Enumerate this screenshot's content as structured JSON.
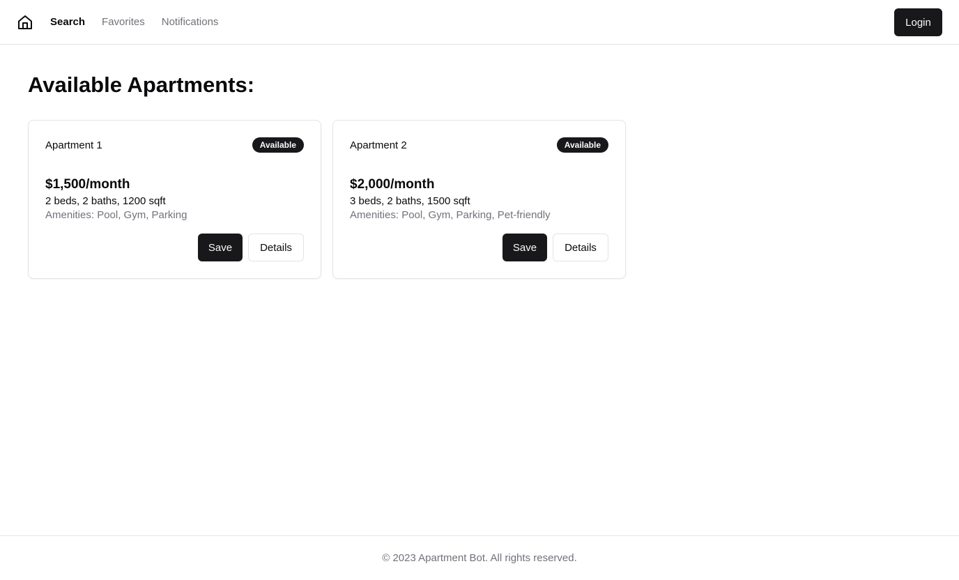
{
  "header": {
    "home_icon": "home-icon",
    "nav": [
      {
        "label": "Search",
        "active": true
      },
      {
        "label": "Favorites",
        "active": false
      },
      {
        "label": "Notifications",
        "active": false
      }
    ],
    "login_label": "Login"
  },
  "main": {
    "title": "Available Apartments:",
    "apartments": [
      {
        "name": "Apartment 1",
        "status": "Available",
        "price": "$1,500/month",
        "specs": "2 beds, 2 baths, 1200 sqft",
        "amenities": "Amenities: Pool, Gym, Parking",
        "save_label": "Save",
        "details_label": "Details"
      },
      {
        "name": "Apartment 2",
        "status": "Available",
        "price": "$2,000/month",
        "specs": "3 beds, 2 baths, 1500 sqft",
        "amenities": "Amenities: Pool, Gym, Parking, Pet-friendly",
        "save_label": "Save",
        "details_label": "Details"
      }
    ]
  },
  "footer": {
    "text": "© 2023 Apartment Bot. All rights reserved."
  },
  "colors": {
    "primary": "#18181b",
    "muted_text": "#71717a",
    "border": "#e4e4e7",
    "background": "#ffffff"
  }
}
